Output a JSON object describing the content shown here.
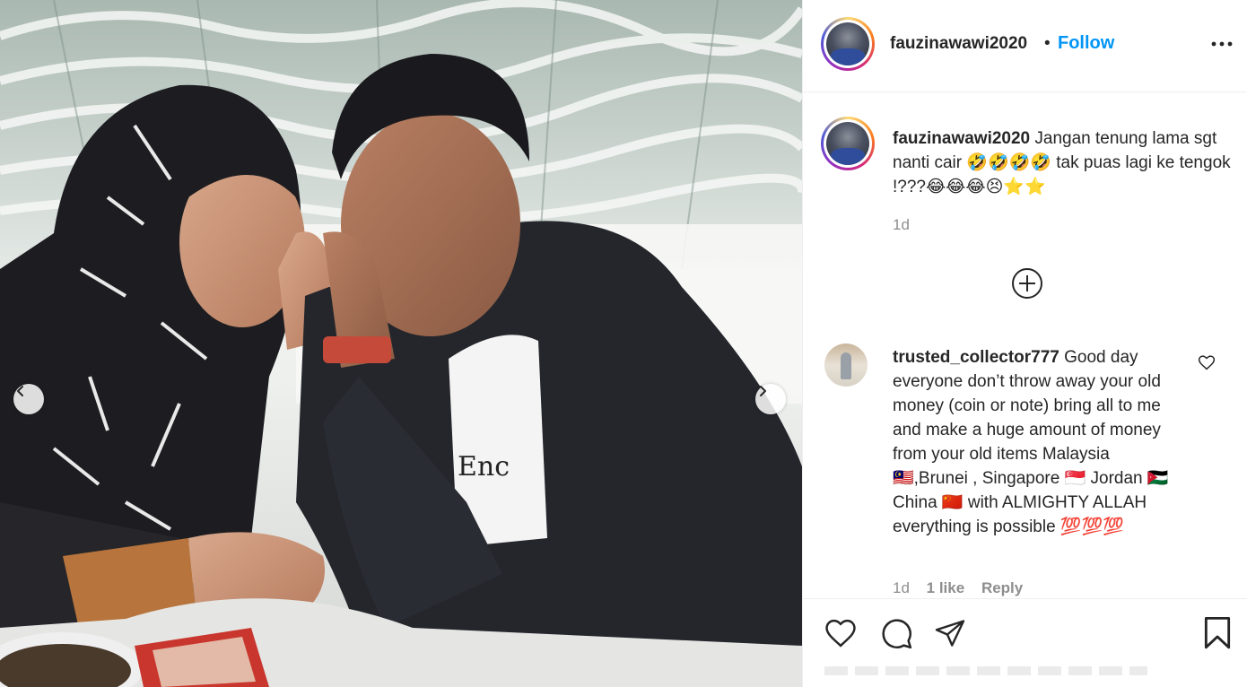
{
  "post": {
    "username": "fauzinawawi2020",
    "follow_label": "Follow",
    "separator": "•"
  },
  "caption": {
    "username": "fauzinawawi2020",
    "text": "Jangan tenung lama sgt nanti cair 🤣🤣🤣🤣 tak puas lagi ke tengok !???😂😂😂😣⭐⭐",
    "time": "1d"
  },
  "comments": [
    {
      "username": "trusted_collector777",
      "text": "Good day everyone don’t throw away your old money (coin or note) bring all to me and make a huge amount of money from your old items Malaysia 🇲🇾,Brunei , Singapore 🇸🇬 Jordan 🇯🇴 China 🇨🇳 with ALMIGHTY ALLAH everything is possible 💯💯💯",
      "time": "1d",
      "likes": "1 like",
      "reply_label": "Reply"
    }
  ],
  "icons": {
    "more": "more-options-icon",
    "load_more": "plus-circle-icon",
    "comment_like": "heart-outline-icon",
    "like": "heart-icon",
    "comment": "speech-bubble-icon",
    "share": "paper-plane-icon",
    "save": "bookmark-icon",
    "prev": "chevron-left-icon",
    "next": "chevron-right-icon"
  },
  "colors": {
    "accent": "#0095f6",
    "text": "#262626",
    "muted": "#8e8e8e",
    "border": "#efefef"
  }
}
